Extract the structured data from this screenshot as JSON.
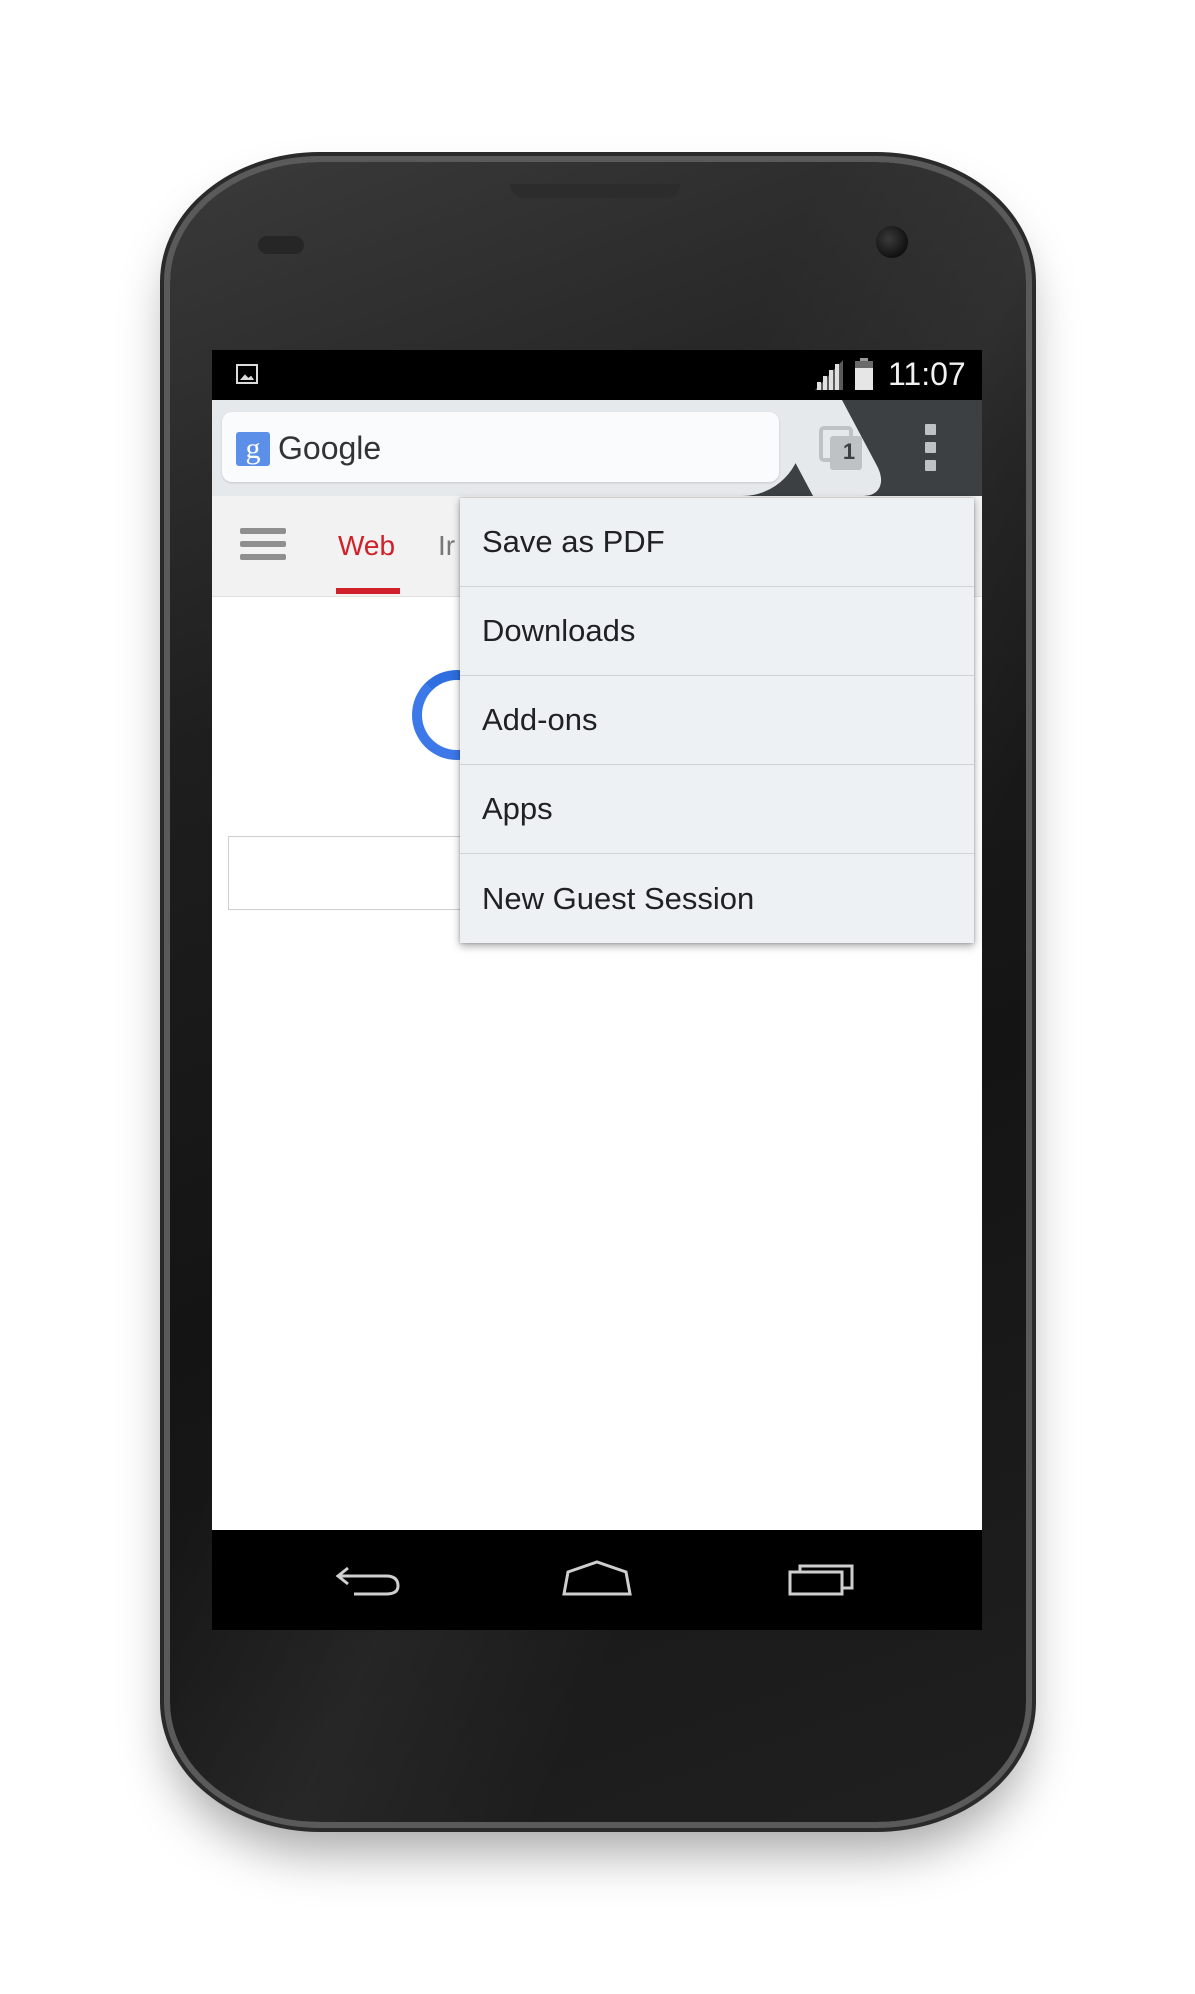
{
  "status_bar": {
    "time": "11:07",
    "left_icon": "picture-notification-icon",
    "signal_icon": "cell-signal-icon",
    "battery_icon": "battery-icon"
  },
  "toolbar": {
    "favicon_letter": "g",
    "url_text": "Google",
    "tab_count": "1",
    "menu_icon": "overflow-menu-icon"
  },
  "page": {
    "nav_active": "Web",
    "nav_next": "Ir",
    "menu_icon": "hamburger-icon"
  },
  "overflow_menu": {
    "items": [
      {
        "label": "Save as PDF"
      },
      {
        "label": "Downloads"
      },
      {
        "label": "Add-ons"
      },
      {
        "label": "Apps"
      },
      {
        "label": "New Guest Session"
      }
    ]
  },
  "nav_bar": {
    "back_icon": "back-icon",
    "home_icon": "home-icon",
    "recents_icon": "recent-apps-icon"
  },
  "colors": {
    "accent_red": "#d0202a",
    "toolbar_dark": "#3c4043",
    "menu_bg": "#eef1f4",
    "google_blue": "#3c78e8"
  }
}
